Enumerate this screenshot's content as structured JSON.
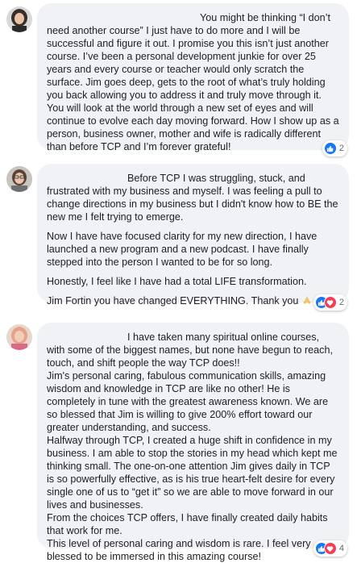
{
  "comments": [
    {
      "paragraphs": [
        "You might be thinking “I don’t need another course” I just have to do more and I will be successful and figure it out. I promise you this isn’t just another course. I’ve been a personal development junkie for over 25 years and every course or teacher would only scratch the surface. Jim goes deep, gets to the root of what’s truly holding you back allowing you to address it and truly move through it. You will look at the world through a new set of eyes and will continue to evolve each day moving forward. How I show up as a person, business owner, mother and wife is radically different than before TCP and I’m forever grateful!"
      ],
      "reactions": {
        "icons": [
          "like-icon"
        ],
        "count": "2"
      }
    },
    {
      "paragraphs": [
        "Before TCP I was struggling, stuck, and frustrated with my business and myself. I was feeling a pull to change directions in my business but I didn't know how to BE the new me I felt trying to emerge.",
        "Now I have have focused clarity for my new direction, I have launched a new program and a new podcast. I have finally stepped into the person I wanted to be for so long.",
        "Honestly, I feel like I have had a total LIFE transformation.",
        "Jim Fortin you have changed EVERYTHING. Thank you"
      ],
      "reactions": {
        "icons": [
          "like-icon",
          "love-icon"
        ],
        "count": "2"
      }
    },
    {
      "paragraphs": [
        "I have taken many spiritual online courses, with some of the biggest names, but none have begun to reach, touch, and shift people the way TCP does!!",
        "Jim's personal caring, fabulous communication skills, amazing wisdom and knowledge in TCP are like no other! He is completely in tune with the greatest awareness known. We are so blessed that Jim is willing to give 200% effort toward our greater understanding, and success.",
        "Halfway through TCP, I created a huge shift in confidence in my business. I am able to stop the stories in my head which kept me thinking small. The one-on-one attention Jim gives daily in TCP is so powerfully effective, as is his true heart-felt desire for every single one of us to “get it” so we are able to move forward in our lives and businesses.",
        "From the choices TCP offers, I have finally created daily habits that work for me.",
        "This level of personal caring and wisdom is rare. I feel very blessed to be immersed in this amazing course!"
      ],
      "reactions": {
        "icons": [
          "like-icon",
          "love-icon"
        ],
        "count": "4"
      }
    }
  ],
  "colors": {
    "bubble": "#f0f2f5",
    "like": "#1877f2",
    "love": "#f33e58",
    "text": "#1c1e21",
    "count": "#65676b"
  }
}
